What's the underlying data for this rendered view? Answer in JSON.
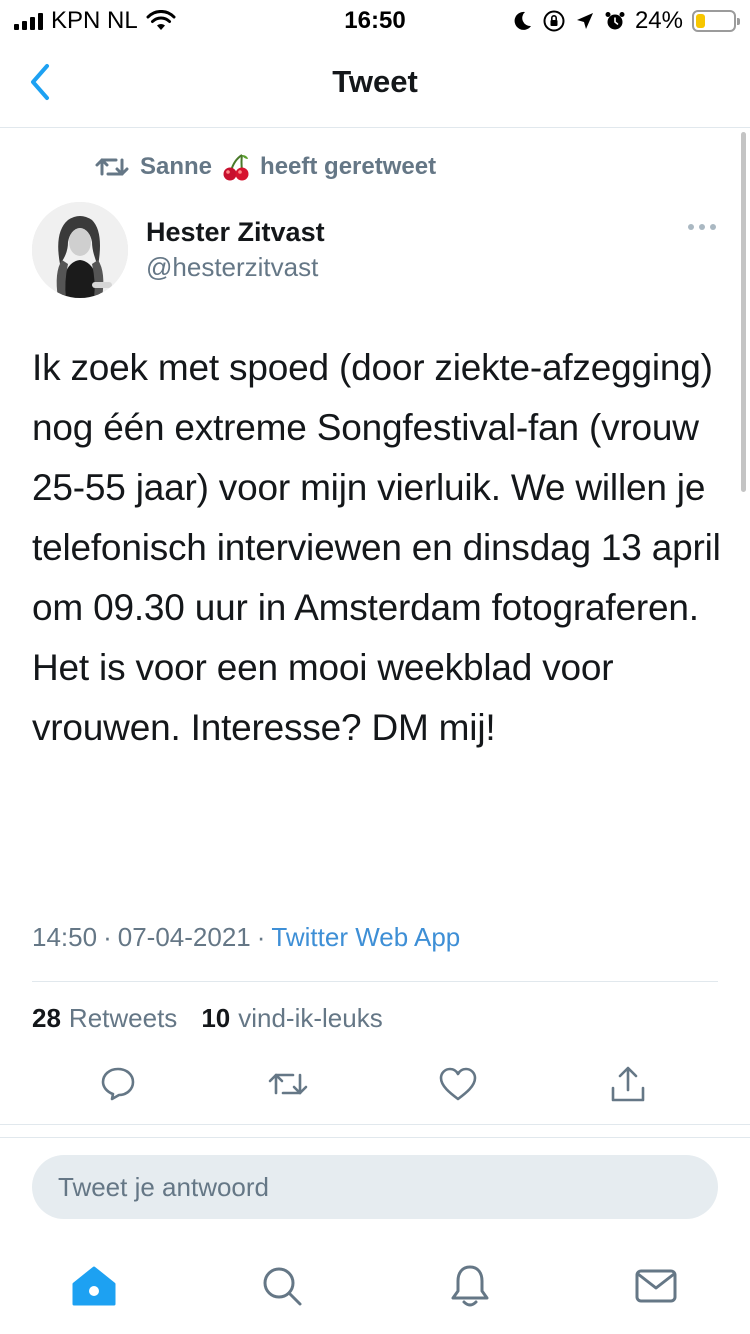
{
  "status_bar": {
    "carrier": "KPN NL",
    "time": "16:50",
    "battery_percent": "24%",
    "battery_level": 0.24,
    "battery_color": "#f7c600"
  },
  "nav": {
    "title": "Tweet",
    "back_icon": "chevron-left-icon"
  },
  "retweet_context": {
    "user": "Sanne",
    "emoji": "cherries",
    "text": "heeft geretweet"
  },
  "tweet": {
    "author_name": "Hester Zitvast",
    "author_handle": "@hesterzitvast",
    "text": "Ik zoek met spoed (door ziekte-afzegging) nog één extreme Songfestival-fan (vrouw 25-55 jaar) voor mijn vierluik. We willen je telefonisch interviewen en dinsdag 13 april om 09.30 uur in Amsterdam fotograferen. Het is voor een mooi weekblad voor vrouwen. Interesse? DM mij!",
    "time": "14:50",
    "date": "07-04-2021",
    "source": "Twitter Web App",
    "retweet_count": "28",
    "retweet_label": "Retweets",
    "like_count": "10",
    "like_label": "vind-ik-leuks"
  },
  "actions": [
    "reply-icon",
    "retweet-icon",
    "like-icon",
    "share-icon"
  ],
  "reply": {
    "placeholder": "Tweet je antwoord"
  },
  "tabbar": [
    "home-icon",
    "search-icon",
    "notifications-icon",
    "messages-icon"
  ],
  "colors": {
    "accent": "#1da1f2",
    "link": "#3e8fd6",
    "secondary_text": "#657786"
  }
}
